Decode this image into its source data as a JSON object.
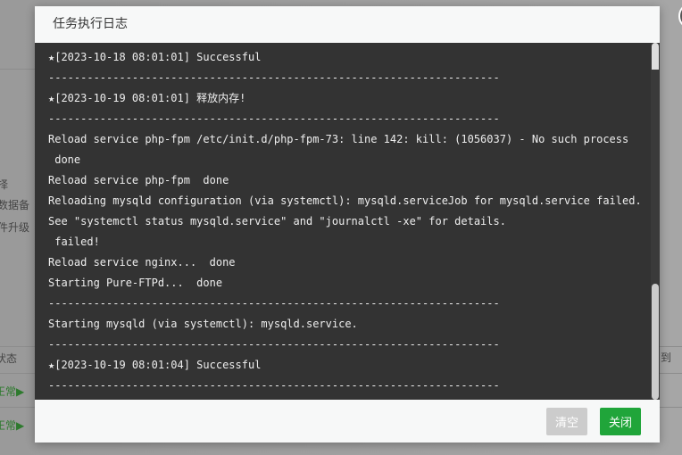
{
  "background": {
    "texts": [
      "择",
      "数据备",
      "件升级",
      "状态",
      "正常▶",
      "正常▶",
      "到"
    ]
  },
  "dialog": {
    "title": "任务执行日志",
    "clear_label": "清空",
    "close_label": "关闭",
    "close_icon": "×",
    "log_lines": [
      "★[2023-10-18 08:01:01] Successful",
      "----------------------------------------------------------------------",
      "★[2023-10-19 08:01:01] 释放内存!",
      "----------------------------------------------------------------------",
      "Reload service php-fpm /etc/init.d/php-fpm-73: line 142: kill: (1056037) - No such process",
      " done",
      "Reload service php-fpm  done",
      "Reloading mysqld configuration (via systemctl): mysqld.serviceJob for mysqld.service failed.",
      "See \"systemctl status mysqld.service\" and \"journalctl -xe\" for details.",
      " failed!",
      "Reload service nginx...  done",
      "Starting Pure-FTPd...  done",
      "----------------------------------------------------------------------",
      "Starting mysqld (via systemctl): mysqld.service.",
      "----------------------------------------------------------------------",
      "★[2023-10-19 08:01:04] Successful",
      "----------------------------------------------------------------------"
    ]
  }
}
